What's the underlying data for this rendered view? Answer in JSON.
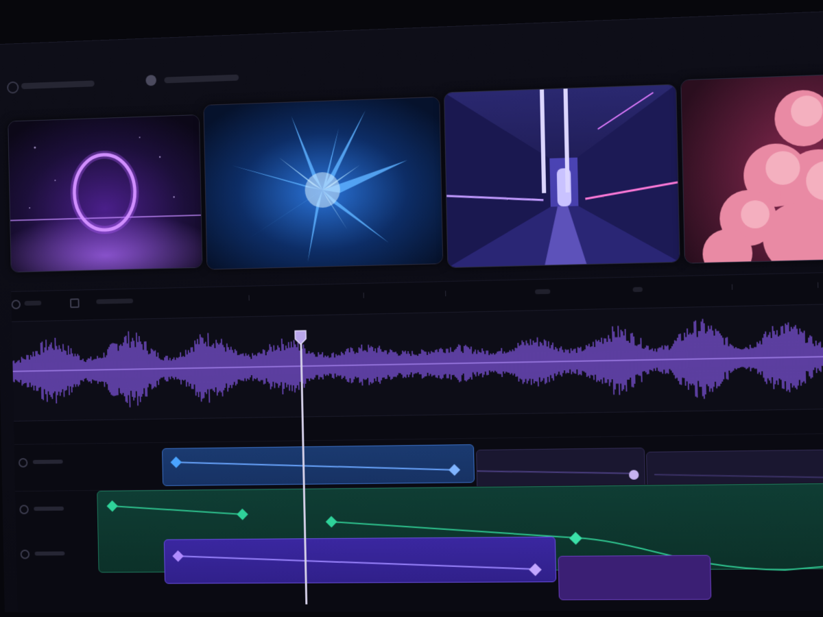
{
  "app": {
    "colors": {
      "background": "#0b0b14",
      "accent_purple": "#8a5cf0",
      "clip_blue": "#1a3a70",
      "clip_green": "#0f3d34",
      "clip_purple": "#3a27a0",
      "keyframe_blue": "#4aa3ff",
      "keyframe_green": "#2fd39a",
      "keyframe_purple": "#b08cff"
    }
  },
  "media_bin": {
    "thumbnails": [
      {
        "subject": "portal-ring-icon"
      },
      {
        "subject": "crystal-burst-icon"
      },
      {
        "subject": "neon-corridor-icon"
      },
      {
        "subject": "pink-cloud-icon"
      }
    ]
  },
  "timeline": {
    "playhead_position": 0.37,
    "tracks": [
      {
        "kind": "audio",
        "icon": "waveform-icon"
      },
      {
        "kind": "video",
        "clips": [
          "blue",
          "dark-purple",
          "dark-purple"
        ]
      },
      {
        "kind": "effects",
        "clips": [
          "green"
        ]
      },
      {
        "kind": "video",
        "clips": [
          "purple",
          "violet"
        ]
      }
    ]
  }
}
